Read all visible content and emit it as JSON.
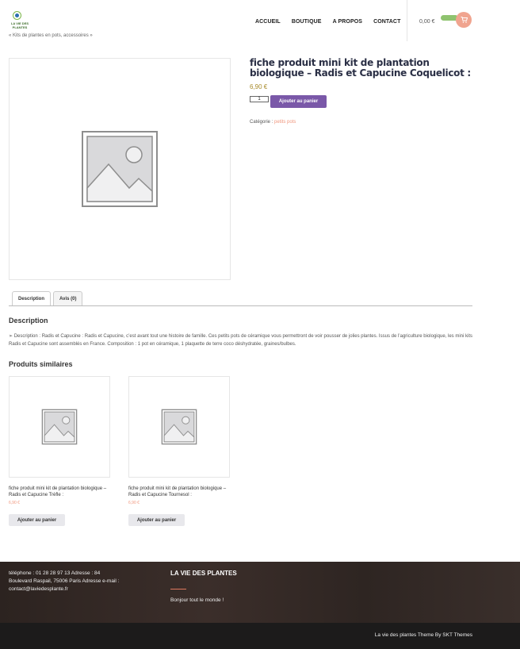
{
  "site": {
    "logo_text": "LA VIE DES PLANTES",
    "tagline": "« Kits de plantes en pots, accessoires »"
  },
  "nav": {
    "items": [
      "ACCUEIL",
      "BOUTIQUE",
      "A PROPOS",
      "CONTACT"
    ]
  },
  "cart": {
    "total": "0,00 €",
    "icon": "cart-icon"
  },
  "product": {
    "title": "fiche produit mini kit de plantation biologique – Radis et Capucine Coquelicot :",
    "price": "6,90 €",
    "quantity": "1",
    "add_to_cart": "Ajouter au panier",
    "category_label": "Catégorie :",
    "category_value": "petits pots"
  },
  "tabs": {
    "description": "Description",
    "reviews": "Avis (0)"
  },
  "description": {
    "heading": "Description",
    "text": "➢ Description : Radis et Capucine : Radis et Capucine, c’est avant tout une histoire de famille. Ces petits pots de céramique vous permettront de voir pousser de jolies plantes. Issus de l’agriculture biologique, les mini kits Radis et Capucine sont assemblés en France. Composition : 1 pot en céramique, 1 plaquette de terre coco déshydratée, graines/bulbes."
  },
  "related": {
    "heading": "Produits similaires",
    "items": [
      {
        "title": "fiche produit mini kit de plantation biologique – Radis et Capucine Trèfle :",
        "price": "6,90 €",
        "button": "Ajouter au panier"
      },
      {
        "title": "fiche produit mini kit de plantation biologique – Radis et Capucine Tournesol :",
        "price": "6,90 €",
        "button": "Ajouter au panier"
      }
    ]
  },
  "footer": {
    "contact": "téléphone : 01 28 28 97 13 Adresse : 84 Boulevard Raspail, 75006 Paris Adresse e-mail : contact@laviedesplante.fr",
    "brand": "LA VIE DES PLANTES",
    "hello": "Bonjour tout le monde !",
    "credit": "La vie des plantes Theme By SKT Themes"
  },
  "colors": {
    "accent_purple": "#7a58a8",
    "accent_salmon": "#f0967d",
    "price_gold": "#a88b2c",
    "footer_bg": "#2c2320"
  }
}
